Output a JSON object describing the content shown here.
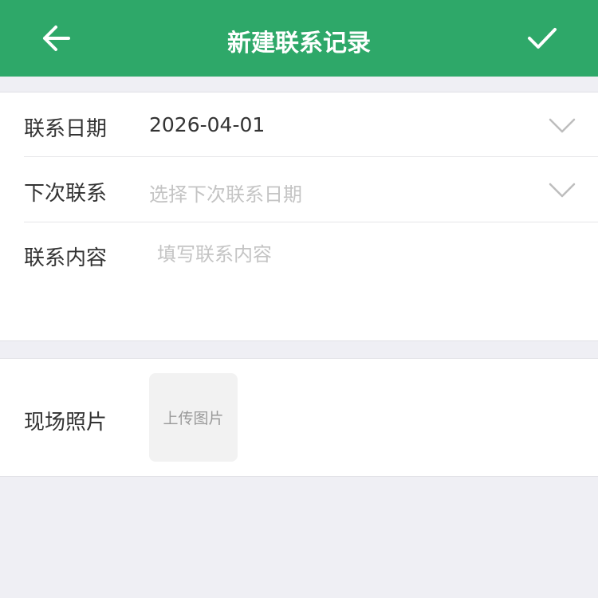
{
  "header": {
    "title": "新建联系记录",
    "back_icon": "arrow-left-icon",
    "confirm_icon": "check-icon",
    "bg_color": "#2ea869"
  },
  "form": {
    "contact_date": {
      "label": "联系日期",
      "value": "2026-04-01"
    },
    "next_contact": {
      "label": "下次联系",
      "placeholder": "选择下次联系日期"
    },
    "contact_content": {
      "label": "联系内容",
      "placeholder": "填写联系内容"
    },
    "photos": {
      "label": "现场照片",
      "upload_label": "上传图片"
    }
  }
}
